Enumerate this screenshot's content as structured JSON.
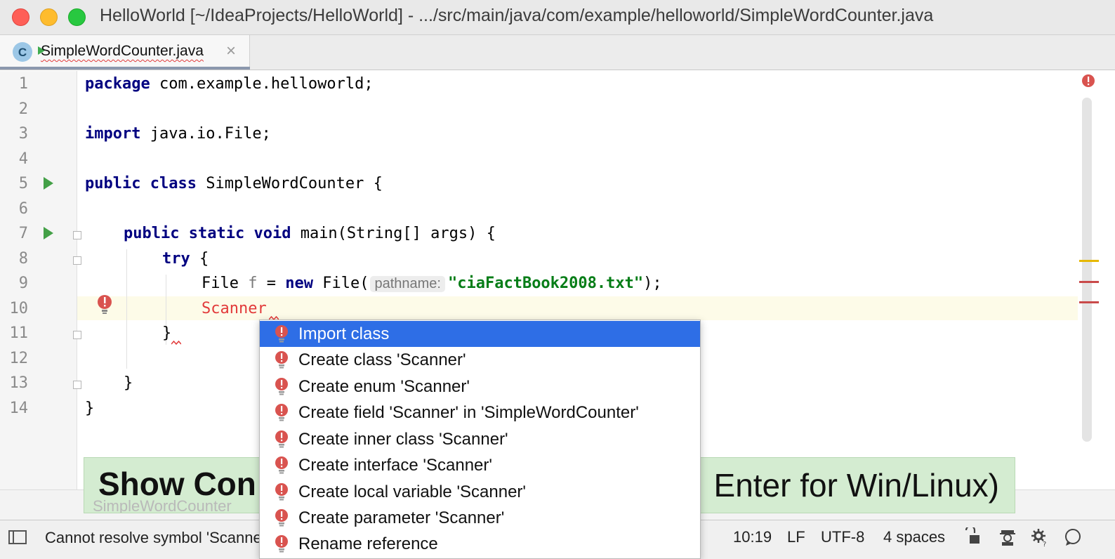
{
  "window": {
    "title": "HelloWorld [~/IdeaProjects/HelloWorld] - .../src/main/java/com/example/helloworld/SimpleWordCounter.java"
  },
  "tab": {
    "icon_letter": "C",
    "label": "SimpleWordCounter.java",
    "close": "×"
  },
  "editor": {
    "line_numbers": [
      "1",
      "2",
      "3",
      "4",
      "5",
      "6",
      "7",
      "8",
      "9",
      "10",
      "11",
      "12",
      "13",
      "14"
    ],
    "code": {
      "l1": {
        "kw": "package",
        "rest": " com.example.helloworld;"
      },
      "l3": {
        "kw": "import",
        "rest": " java.io.File;"
      },
      "l5": {
        "kw1": "public",
        "kw2": "class",
        "rest": " SimpleWordCounter {"
      },
      "l7": {
        "kw1": "public",
        "kw2": "static",
        "kw3": "void",
        "rest": " main(String[] args) {"
      },
      "l8": {
        "kw": "try",
        "rest": " {"
      },
      "l9": {
        "t1": "File ",
        "var": "f",
        "t2": " = ",
        "kw": "new",
        "t3": " File(",
        "hint": "pathname:",
        "str": "\"ciaFactBook2008.txt\"",
        "t4": ");"
      },
      "l10": {
        "err": "Scanner"
      },
      "l11": {
        "text": "}"
      },
      "l13": {
        "text": "}"
      },
      "l14": {
        "text": "}"
      }
    }
  },
  "popup": {
    "items": [
      "Import class",
      "Create class 'Scanner'",
      "Create enum 'Scanner'",
      "Create field 'Scanner' in 'SimpleWordCounter'",
      "Create inner class 'Scanner'",
      "Create interface 'Scanner'",
      "Create local variable 'Scanner'",
      "Create parameter 'Scanner'",
      "Rename reference"
    ],
    "selected_index": 0
  },
  "banner": {
    "text_start": "Show Con",
    "text_end": "Enter for Win/Linux)",
    "ghost": "SimpleWordCounter"
  },
  "status": {
    "message": "Cannot resolve symbol 'Scanne",
    "position": "10:19",
    "line_sep": "LF",
    "encoding": "UTF-8",
    "indent": "4 spaces"
  },
  "colors": {
    "selection": "#2e6ee6",
    "error": "#e23a3a",
    "keyword": "#000080",
    "string": "#067d17",
    "banner": "#d4ecd1"
  },
  "icons": [
    "error-bulb-icon",
    "run-icon",
    "lock-icon",
    "inspector-icon",
    "settings-icon",
    "feedback-icon",
    "tool-window-icon"
  ]
}
